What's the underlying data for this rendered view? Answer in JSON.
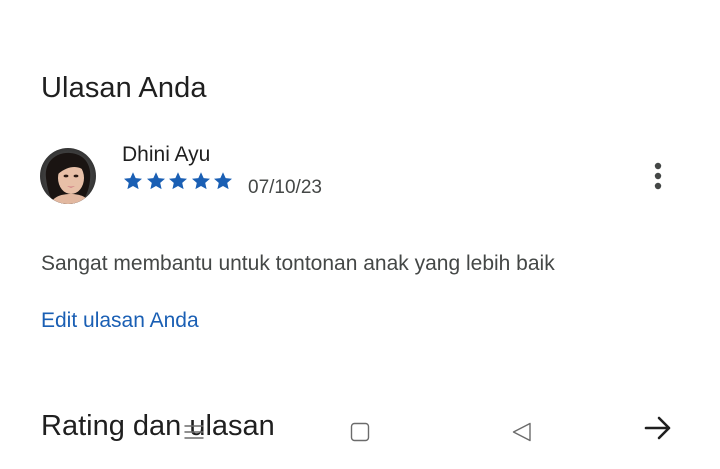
{
  "section": {
    "title": "Ulasan Anda"
  },
  "review": {
    "reviewer_name": "Dhini Ayu",
    "rating": 5,
    "max_rating": 5,
    "date": "07/10/23",
    "text": "Sangat membantu untuk tontonan anak yang lebih baik",
    "edit_label": "Edit ulasan Anda",
    "more_icon": "more-vert-icon",
    "star_color": "#1a5fb4"
  },
  "ratings_section": {
    "title": "Rating dan ulasan",
    "arrow_icon": "arrow-forward-icon"
  },
  "system_nav": {
    "icons": [
      "menu-icon",
      "home-square-icon",
      "back-triangle-icon"
    ]
  }
}
